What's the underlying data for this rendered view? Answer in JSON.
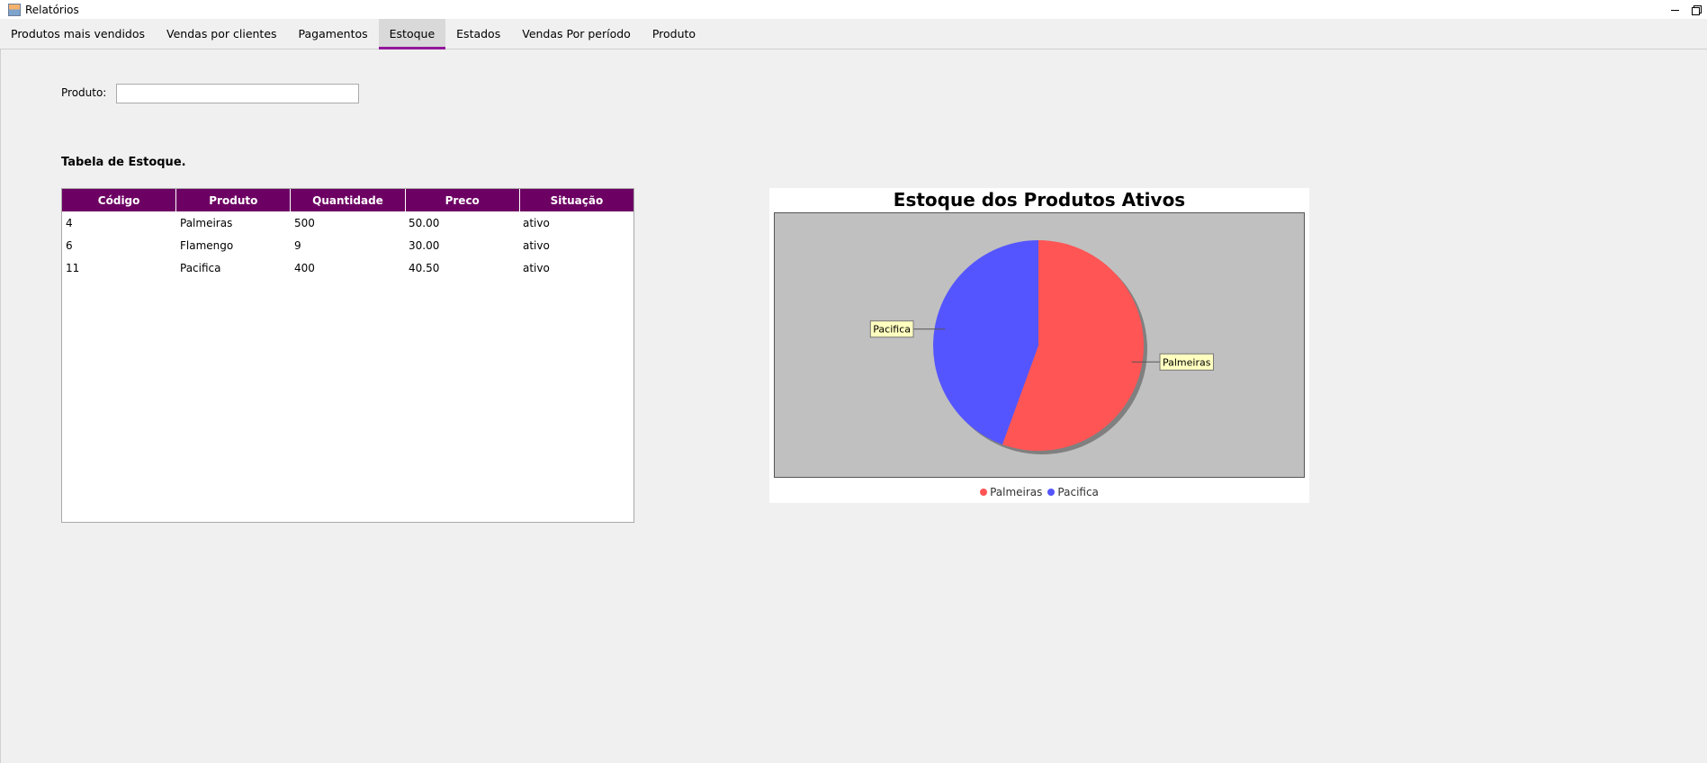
{
  "window": {
    "title": "Relatórios"
  },
  "tabs": [
    {
      "label": "Produtos mais vendidos",
      "active": false
    },
    {
      "label": "Vendas por clientes",
      "active": false
    },
    {
      "label": "Pagamentos",
      "active": false
    },
    {
      "label": "Estoque",
      "active": true
    },
    {
      "label": "Estados",
      "active": false
    },
    {
      "label": "Vendas Por período",
      "active": false
    },
    {
      "label": "Produto",
      "active": false
    }
  ],
  "filter": {
    "label": "Produto:",
    "value": "",
    "placeholder": ""
  },
  "table": {
    "title": "Tabela de Estoque.",
    "columns": [
      "Código",
      "Produto",
      "Quantidade",
      "Preco",
      "Situação"
    ],
    "rows": [
      [
        "4",
        "Palmeiras",
        "500",
        "50.00",
        "ativo"
      ],
      [
        "6",
        "Flamengo",
        "9",
        "30.00",
        "ativo"
      ],
      [
        "11",
        "Pacifica",
        "400",
        "40.50",
        "ativo"
      ]
    ],
    "header_color": "#6d0063"
  },
  "colors": {
    "accent_tab": "#93189b",
    "plot_background": "#c0c0c0"
  },
  "chart_data": {
    "type": "pie",
    "title": "Estoque dos Produtos Ativos",
    "slices": [
      {
        "label": "Palmeiras",
        "value": 500,
        "color": "#ff5555"
      },
      {
        "label": "Pacifica",
        "value": 400,
        "color": "#5555ff"
      }
    ],
    "legend": [
      "Palmeiras",
      "Pacifica"
    ],
    "legend_position": "bottom"
  }
}
